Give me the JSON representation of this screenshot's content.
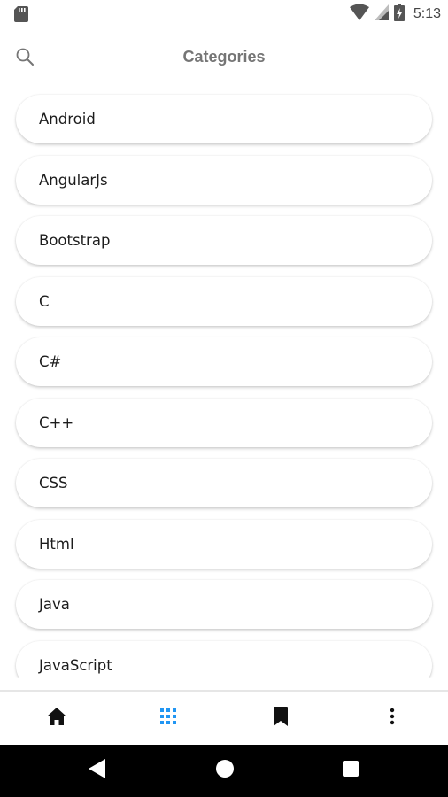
{
  "status_bar": {
    "time": "5:13"
  },
  "header": {
    "title": "Categories",
    "search_icon": "search-icon"
  },
  "categories": [
    {
      "label": "Android"
    },
    {
      "label": "AngularJs"
    },
    {
      "label": "Bootstrap"
    },
    {
      "label": "C"
    },
    {
      "label": "C#"
    },
    {
      "label": "C++"
    },
    {
      "label": "CSS"
    },
    {
      "label": "Html"
    },
    {
      "label": "Java"
    },
    {
      "label": "JavaScript"
    }
  ],
  "bottom_nav": {
    "active": "categories",
    "items": [
      {
        "id": "home",
        "icon": "home-icon"
      },
      {
        "id": "categories",
        "icon": "grid-icon"
      },
      {
        "id": "bookmarks",
        "icon": "bookmark-icon"
      },
      {
        "id": "more",
        "icon": "more-vertical-icon"
      }
    ]
  },
  "colors": {
    "accent": "#2196F3",
    "nav_icon": "#111111",
    "title": "#757575",
    "system_bar": "#000000"
  }
}
